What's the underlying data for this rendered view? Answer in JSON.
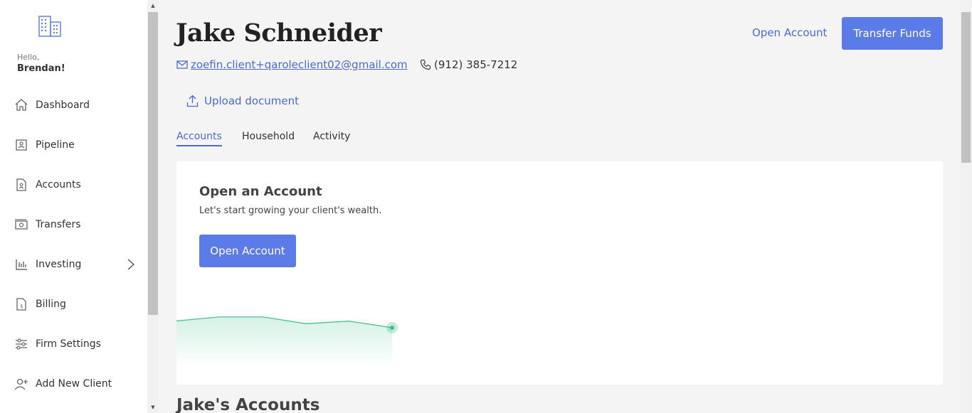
{
  "sidebar": {
    "greeting": "Hello,",
    "user": "Brendan!",
    "items": [
      {
        "label": "Dashboard",
        "icon": "home-icon"
      },
      {
        "label": "Pipeline",
        "icon": "pipeline-icon"
      },
      {
        "label": "Accounts",
        "icon": "document-icon"
      },
      {
        "label": "Transfers",
        "icon": "money-icon"
      },
      {
        "label": "Investing",
        "icon": "chart-bars-icon",
        "has_children": true
      },
      {
        "label": "Billing",
        "icon": "billing-icon"
      },
      {
        "label": "Firm Settings",
        "icon": "sliders-icon"
      },
      {
        "label": "Add New Client",
        "icon": "add-user-icon"
      }
    ]
  },
  "client": {
    "name": "Jake Schneider",
    "email": "zoefin.client+qaroleclient02@gmail.com",
    "phone": "(912) 385-7212",
    "upload_label": "Upload document"
  },
  "header": {
    "open_account_link": "Open Account",
    "transfer_button": "Transfer Funds"
  },
  "tabs": [
    {
      "label": "Accounts",
      "active": true
    },
    {
      "label": "Household",
      "active": false
    },
    {
      "label": "Activity",
      "active": false
    }
  ],
  "card": {
    "title": "Open an Account",
    "subtitle": "Let's start growing your client's wealth.",
    "button": "Open Account",
    "sparkline": [
      0.4,
      0.05,
      0.05,
      0.65,
      0.42,
      1.0
    ]
  },
  "section": {
    "title": "Jake's Accounts"
  },
  "colors": {
    "accent": "#5b7be9",
    "link": "#4a68d8",
    "sparkline": "#3dbf8a"
  }
}
